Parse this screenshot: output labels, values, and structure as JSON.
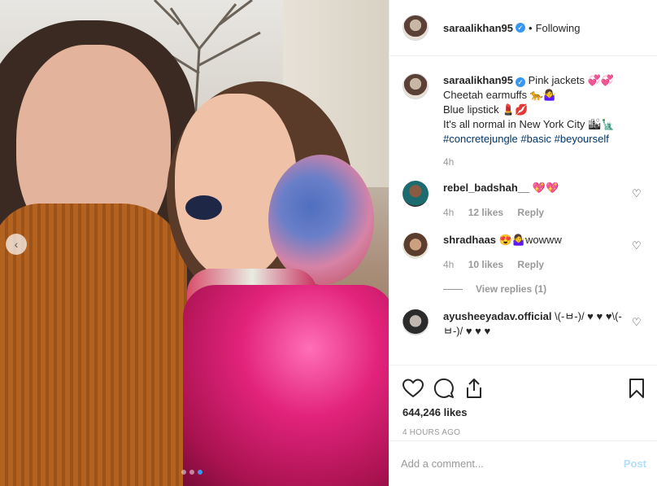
{
  "post": {
    "username": "saraalikhan95",
    "separator": "•",
    "follow_status": "Following"
  },
  "caption": {
    "username": "saraalikhan95",
    "line1": "Pink jackets 💞💞",
    "line2": "Cheetah earmuffs 🐆🤷‍♀️",
    "line3": "Blue lipstick 💄💋",
    "line4": "It's all normal in New York City 🏙🗽",
    "hashtags": [
      "#concretejungle",
      "#basic",
      "#beyourself"
    ],
    "time": "4h"
  },
  "comments": [
    {
      "username": "rebel_badshah__",
      "text": "💖💖",
      "time": "4h",
      "likes": "12 likes",
      "reply": "Reply"
    },
    {
      "username": "shradhaas",
      "text": "😍🤷‍♀️wowww",
      "time": "4h",
      "likes": "10 likes",
      "reply": "Reply",
      "view_replies": "View replies (1)"
    },
    {
      "username": "ayusheeyadav.official",
      "text": "\\(-ㅂ-)/ ♥ ♥ ♥\\(-ㅂ-)/ ♥ ♥ ♥"
    }
  ],
  "stats": {
    "likes": "644,246 likes",
    "posted": "4 HOURS AGO"
  },
  "add_comment": {
    "placeholder": "Add a comment...",
    "post_label": "Post"
  },
  "colors": {
    "link": "#003569",
    "verified": "#3897f0",
    "post_disabled": "#b2dffc",
    "muted": "#999999"
  },
  "carousel": {
    "count": 3,
    "active": 3
  }
}
